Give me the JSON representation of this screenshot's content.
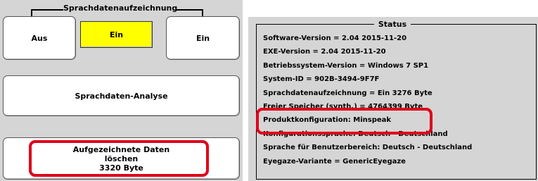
{
  "recording_group": {
    "title": "Sprachdatenaufzeichnung",
    "btn_off": "Aus",
    "btn_on_active": "Ein",
    "btn_on": "Ein"
  },
  "analysis_button": "Sprachdaten-Analyse",
  "delete_button": {
    "line1": "Aufgezeichnete Daten",
    "line2": "löschen",
    "line3": "3320  Byte"
  },
  "status": {
    "title": "Status",
    "lines": [
      "Software-Version = 2.04 2015-11-20",
      "EXE-Version = 2.04 2015-11-20",
      "Betriebssystem-Version = Windows 7 SP1",
      "System-ID = 902B-3494-9F7F",
      "Sprachdatenaufzeichnung = Ein 3276 Byte",
      "Freier Speicher (synth.) = 4764399 Byte",
      "Produktkonfiguration: Minspeak",
      "Konfigurationssprache: Deutsch - Deutschland",
      "Sprache für Benutzerbereich: Deutsch - Deutschland",
      "Eyegaze-Variante =  GenericEyegaze"
    ]
  },
  "colors": {
    "active_yellow": "#ffff00",
    "highlight_red": "#e0001a",
    "panel_gray": "#d5d5d5"
  }
}
